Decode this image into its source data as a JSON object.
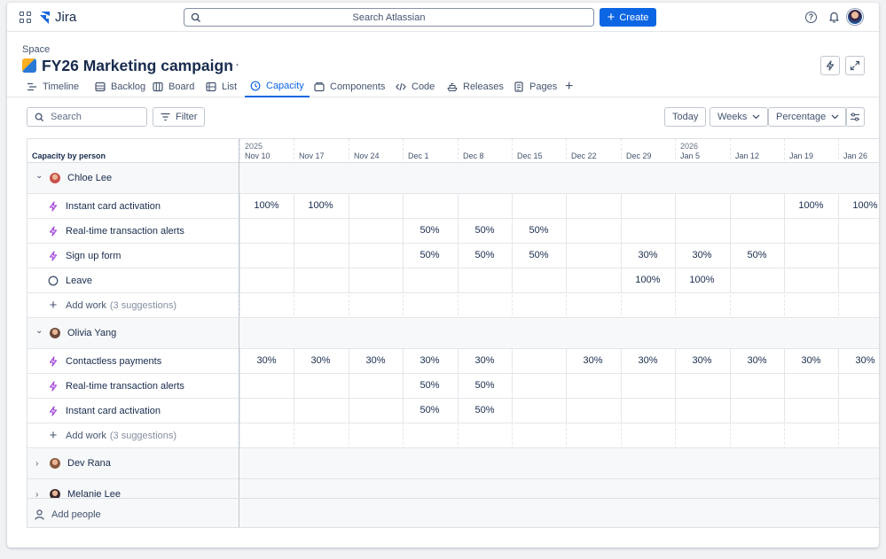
{
  "topnav": {
    "product_name": "Jira",
    "search_placeholder": "Search Atlassian",
    "create_label": "Create"
  },
  "header": {
    "space_label": "Space",
    "project_title": "FY26 Marketing campaign"
  },
  "tabs": [
    {
      "label": "Timeline"
    },
    {
      "label": "Backlog"
    },
    {
      "label": "Board"
    },
    {
      "label": "List"
    },
    {
      "label": "Capacity",
      "active": true
    },
    {
      "label": "Components"
    },
    {
      "label": "Code"
    },
    {
      "label": "Releases"
    },
    {
      "label": "Pages"
    }
  ],
  "toolbar": {
    "search_placeholder": "Search",
    "filter_label": "Filter",
    "today_label": "Today",
    "weeks_label": "Weeks",
    "percentage_label": "Percentage"
  },
  "grid": {
    "column_title": "Capacity by person",
    "years": [
      {
        "label": "2025",
        "col": 0
      },
      {
        "label": "2026",
        "col": 8
      }
    ],
    "weeks": [
      "Nov 10",
      "Nov 17",
      "Nov 24",
      "Dec 1",
      "Dec 8",
      "Dec 15",
      "Dec 22",
      "Dec 29",
      "Jan 5",
      "Jan 12",
      "Jan 19",
      "Jan 26"
    ],
    "people": [
      {
        "name": "Chloe Lee",
        "expanded": true,
        "items": [
          {
            "label": "Instant card activation",
            "type": "work",
            "values": [
              "100%",
              "100%",
              "",
              "",
              "",
              "",
              "",
              "",
              "",
              "",
              "100%",
              "100%"
            ]
          },
          {
            "label": "Real-time transaction alerts",
            "type": "work",
            "values": [
              "",
              "",
              "",
              "50%",
              "50%",
              "50%",
              "",
              "",
              "",
              "",
              "",
              ""
            ]
          },
          {
            "label": "Sign up form",
            "type": "work",
            "values": [
              "",
              "",
              "",
              "50%",
              "50%",
              "50%",
              "",
              "30%",
              "30%",
              "50%",
              "",
              ""
            ]
          },
          {
            "label": "Leave",
            "type": "leave",
            "values": [
              "",
              "",
              "",
              "",
              "",
              "",
              "",
              "100%",
              "100%",
              "",
              "",
              ""
            ]
          }
        ],
        "add_work_label": "Add work",
        "add_work_suggestions": "(3 suggestions)"
      },
      {
        "name": "Olivia Yang",
        "expanded": true,
        "items": [
          {
            "label": "Contactless payments",
            "type": "work",
            "values": [
              "30%",
              "30%",
              "30%",
              "30%",
              "30%",
              "",
              "30%",
              "30%",
              "30%",
              "30%",
              "30%",
              "30%"
            ]
          },
          {
            "label": "Real-time transaction alerts",
            "type": "work",
            "values": [
              "",
              "",
              "",
              "50%",
              "50%",
              "",
              "",
              "",
              "",
              "",
              "",
              ""
            ]
          },
          {
            "label": "Instant card activation",
            "type": "work",
            "values": [
              "",
              "",
              "",
              "50%",
              "50%",
              "",
              "",
              "",
              "",
              "",
              "",
              ""
            ]
          }
        ],
        "add_work_label": "Add work",
        "add_work_suggestions": "(3 suggestions)"
      },
      {
        "name": "Dev Rana",
        "expanded": false
      },
      {
        "name": "Melanie Lee",
        "expanded": false
      }
    ],
    "add_people_label": "Add people"
  },
  "colors": {
    "accent": "#0c66e4",
    "capacity_fill": "#e9f2ff",
    "capacity_line": "#1d7afc",
    "overload_fill": "#ffe2e0",
    "overload_line": "#e2483d",
    "work_icon": "#a54cdb"
  }
}
